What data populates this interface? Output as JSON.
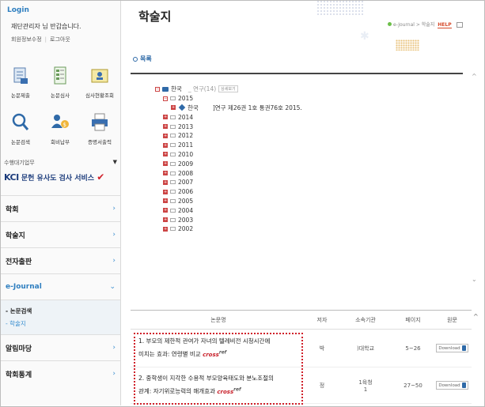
{
  "sidebar": {
    "login_title": "Login",
    "welcome": "재단관리자 님 반갑습니다.",
    "links": [
      "회원정보수정",
      "로그아웃"
    ],
    "quick": [
      {
        "label": "논문제출",
        "icon": "document-submit-icon"
      },
      {
        "label": "논문심사",
        "icon": "review-sheet-icon"
      },
      {
        "label": "심사현황조회",
        "icon": "status-lookup-icon"
      },
      {
        "label": "논문검색",
        "icon": "magnifier-icon"
      },
      {
        "label": "회비납부",
        "icon": "dues-payment-icon"
      },
      {
        "label": "증명서출력",
        "icon": "printer-icon"
      }
    ],
    "service_head": "수행대기업무",
    "kci_logo": "KCI",
    "kci_text": "문헌 유사도 검사 서비스",
    "menu": [
      "학회",
      "학술지",
      "전자출판",
      "e-Journal",
      "알림마당",
      "학회통계"
    ],
    "submenu": [
      "- 논문검색",
      "- 학술지"
    ]
  },
  "main": {
    "title": "학술지",
    "breadcrumb": "e-Journal > 학술지",
    "help": "HELP",
    "section": "목록",
    "tree": {
      "root": "한국",
      "root_suffix": "_ 연구(14)",
      "root_btn": "상세보기",
      "open_year": "2015",
      "issue_journal": "한국",
      "issue_text": "]연구 제26권 1호 통권76호 2015.",
      "years": [
        "2014",
        "2013",
        "2012",
        "2011",
        "2010",
        "2009",
        "2008",
        "2007",
        "2006",
        "2005",
        "2004",
        "2003",
        "2002"
      ]
    },
    "table": {
      "headers": [
        "논문명",
        "저자",
        "소속기관",
        "페이지",
        "원문"
      ],
      "rows": [
        {
          "title_line1": "1. 부모의 제한적 관여가 자녀의 텔레비전 시청시간에",
          "title_line2": "미치는 효과: 연령별 비교",
          "author": "박",
          "affiliation": ")대학교",
          "pages": "5~26",
          "download": "Download"
        },
        {
          "title_line1": "2. 중학생이 지각한 수용적 부모양육태도와 분노조절의",
          "title_line2": "관계: 자기위로능력의 매개효과",
          "author": "정",
          "affiliation": "1육청",
          "affiliation2": "1",
          "pages": "27~50",
          "download": "Download"
        }
      ],
      "crossref_text": "cross",
      "crossref_sup": "ref"
    }
  },
  "colors": {
    "accent": "#2f7fc0",
    "highlight": "#d0202a",
    "help": "#d64a2a"
  }
}
